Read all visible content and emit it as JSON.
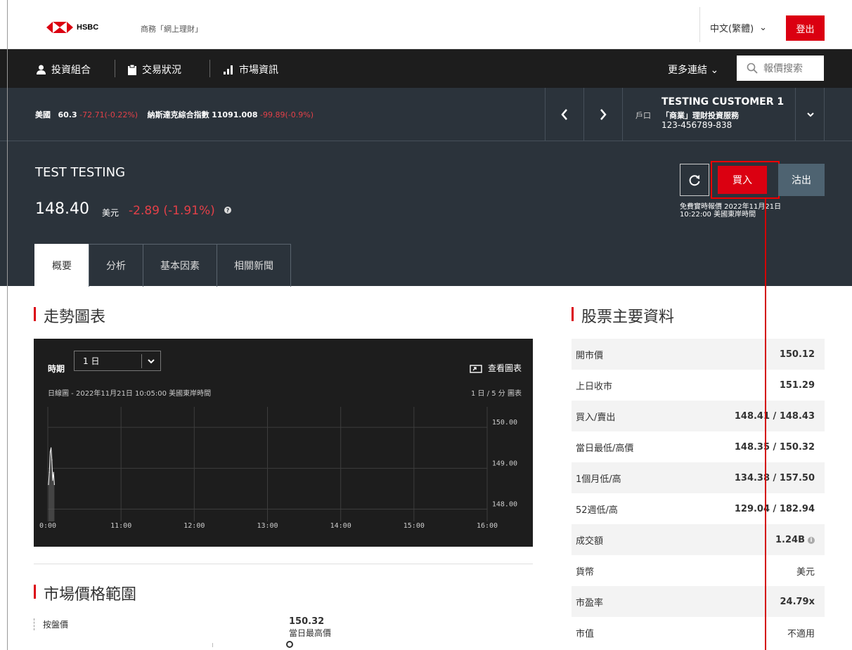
{
  "header": {
    "logo_text": "HSBC",
    "tagline": "商務「網上理財」",
    "language": "中文(繁體)",
    "logout": "登出"
  },
  "nav": {
    "portfolio": "投資組合",
    "transactions": "交易狀況",
    "market_info": "市場資訊",
    "more_links": "更多連結",
    "quote_search": "報價搜索"
  },
  "ticker": {
    "region": "美國",
    "index1_value": "60.3",
    "index1_change": "-72.71(-0.22%)",
    "index2_name": "納斯達克綜合指數",
    "index2_value": "11091.008",
    "index2_change": "-99.89(-0.9%)"
  },
  "customer": {
    "name": "TESTING CUSTOMER 1",
    "account_label": "戶口",
    "service": "「商業」理財投資服務",
    "account_number": "123-456789-838"
  },
  "stock": {
    "name": "TEST TESTING",
    "price": "148.40",
    "currency": "美元",
    "change": "-2.89 (-1.91%)",
    "buy": "買入",
    "sell": "沽出",
    "realtime_line1": "免費實時報價 2022年11月21日",
    "realtime_line2": "10:22:00 美國東岸時間"
  },
  "tabs": [
    {
      "label": "概要",
      "active": true
    },
    {
      "label": "分析",
      "active": false
    },
    {
      "label": "基本因素",
      "active": false
    },
    {
      "label": "相關新聞",
      "active": false
    }
  ],
  "trend": {
    "title": "走勢圖表",
    "period_label": "時期",
    "period_value": "1 日",
    "view_chart": "查看圖表",
    "caption": "日線圖 - 2022年11月21日 10:05:00 美國東岸時間",
    "interval": "1 日 / 5 分 圖表"
  },
  "chart_data": {
    "type": "line",
    "x_ticks": [
      "0:00",
      "11:00",
      "12:00",
      "13:00",
      "14:00",
      "15:00",
      "16:00"
    ],
    "y_ticks": [
      "150.00",
      "149.00",
      "148.00"
    ],
    "ylim": [
      147.7,
      150.5
    ],
    "x": [
      "9:30",
      "9:35",
      "9:40",
      "9:45",
      "9:50",
      "9:55",
      "10:00",
      "10:05"
    ],
    "series": [
      {
        "values": [
          148.6,
          148.9,
          149.4,
          149.5,
          149.2,
          148.7,
          148.9,
          148.6
        ]
      }
    ]
  },
  "range": {
    "title": "市場價格範圍",
    "label": "按盤價",
    "high_value": "150.32",
    "high_label": "當日最高價"
  },
  "key_data": {
    "title": "股票主要資料",
    "rows": [
      {
        "k": "開市價",
        "v": "150.12"
      },
      {
        "k": "上日收市",
        "v": "151.29"
      },
      {
        "k": "買入/賣出",
        "v": "148.41 / 148.43"
      },
      {
        "k": "當日最低/高價",
        "v": "148.35 / 150.32"
      },
      {
        "k": "1個月低/高",
        "v": "134.38 / 157.50"
      },
      {
        "k": "52週低/高",
        "v": "129.04 / 182.94"
      },
      {
        "k": "成交額",
        "v": "1.24B"
      },
      {
        "k": "貨幣",
        "v": "美元"
      },
      {
        "k": "市盈率",
        "v": "24.79x"
      },
      {
        "k": "市值",
        "v": "不適用"
      }
    ]
  },
  "colors": {
    "brand_red": "#db0011",
    "negative": "#e34048",
    "dark_bg": "#2b333b",
    "nav_bg": "#1d1d1d"
  }
}
